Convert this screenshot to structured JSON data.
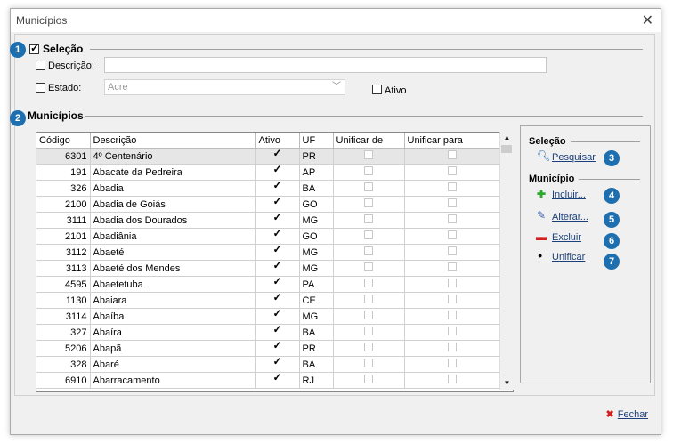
{
  "window": {
    "title": "Municípios",
    "close_glyph": "✕"
  },
  "selecao": {
    "badge": "1",
    "title": "Seleção",
    "descricao_label": "Descrição:",
    "descricao_value": "",
    "estado_label": "Estado:",
    "estado_value": "Acre",
    "ativo_label": "Ativo"
  },
  "municipios": {
    "badge": "2",
    "title": "Municípios",
    "columns": [
      "Código",
      "Descrição",
      "Ativo",
      "UF",
      "Unificar de",
      "Unificar para"
    ],
    "rows": [
      {
        "codigo": "6301",
        "descricao": "4º Centenário",
        "ativo": true,
        "uf": "PR"
      },
      {
        "codigo": "191",
        "descricao": "Abacate da Pedreira",
        "ativo": true,
        "uf": "AP"
      },
      {
        "codigo": "326",
        "descricao": "Abadia",
        "ativo": true,
        "uf": "BA"
      },
      {
        "codigo": "2100",
        "descricao": "Abadia de Goiás",
        "ativo": true,
        "uf": "GO"
      },
      {
        "codigo": "3111",
        "descricao": "Abadia dos Dourados",
        "ativo": true,
        "uf": "MG"
      },
      {
        "codigo": "2101",
        "descricao": "Abadiânia",
        "ativo": true,
        "uf": "GO"
      },
      {
        "codigo": "3112",
        "descricao": "Abaeté",
        "ativo": true,
        "uf": "MG"
      },
      {
        "codigo": "3113",
        "descricao": "Abaeté dos Mendes",
        "ativo": true,
        "uf": "MG"
      },
      {
        "codigo": "4595",
        "descricao": "Abaetetuba",
        "ativo": true,
        "uf": "PA"
      },
      {
        "codigo": "1130",
        "descricao": "Abaiara",
        "ativo": true,
        "uf": "CE"
      },
      {
        "codigo": "3114",
        "descricao": "Abaíba",
        "ativo": true,
        "uf": "MG"
      },
      {
        "codigo": "327",
        "descricao": "Abaíra",
        "ativo": true,
        "uf": "BA"
      },
      {
        "codigo": "5206",
        "descricao": "Abapã",
        "ativo": true,
        "uf": "PR"
      },
      {
        "codigo": "328",
        "descricao": "Abaré",
        "ativo": true,
        "uf": "BA"
      },
      {
        "codigo": "6910",
        "descricao": "Abarracamento",
        "ativo": true,
        "uf": "RJ"
      }
    ]
  },
  "side": {
    "selecao_title": "Seleção",
    "pesquisar": "Pesquisar",
    "pesquisar_badge": "3",
    "municipio_title": "Município",
    "incluir": "Incluir...",
    "incluir_badge": "4",
    "alterar": "Alterar...",
    "alterar_badge": "5",
    "excluir": "Excluir",
    "excluir_badge": "6",
    "unificar": "Unificar",
    "unificar_badge": "7"
  },
  "footer": {
    "fechar": "Fechar"
  },
  "colors": {
    "badge": "#1d6fb0",
    "link": "#1a3f7a"
  }
}
